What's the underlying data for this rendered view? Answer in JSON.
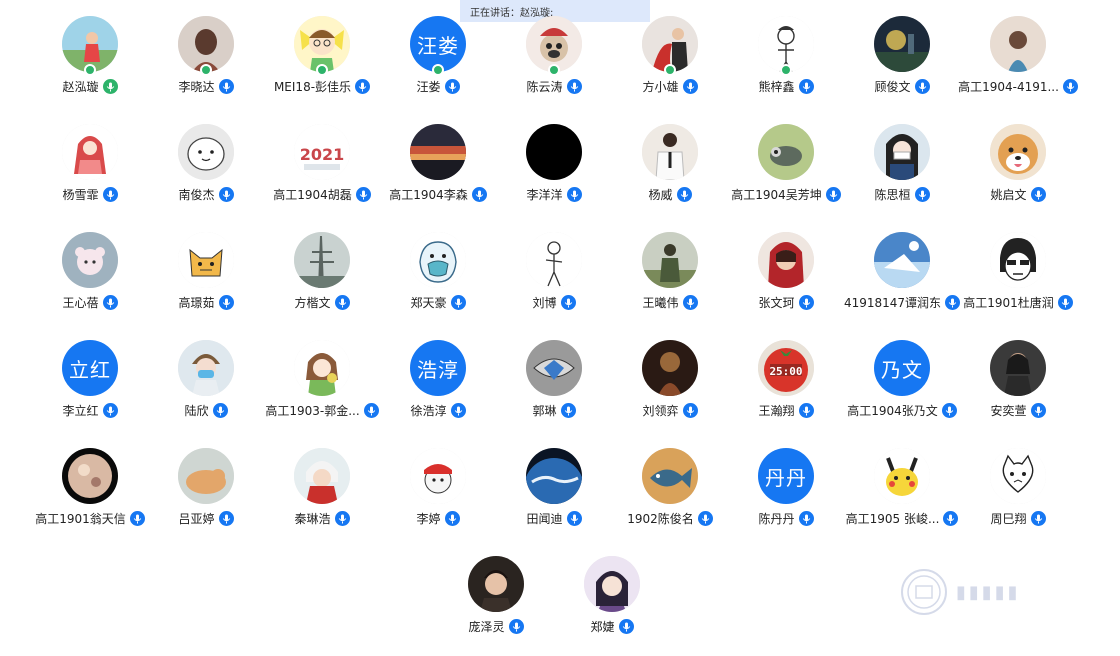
{
  "banner": {
    "text": "正在讲话：赵泓璇;"
  },
  "colors": {
    "accent": "#1677f2",
    "status_green": "#2db36a",
    "banner_bg": "#dde8fb"
  },
  "participants": [
    {
      "name": "赵泓璇",
      "avatar": "photo-girl-garden",
      "mic": "green",
      "status": true
    },
    {
      "name": "李晓达",
      "avatar": "photo-girl-back",
      "mic": "blue",
      "status": true
    },
    {
      "name": "MEI18-彭佳乐",
      "avatar": "cartoon-boy-yellow",
      "mic": "blue",
      "status": true
    },
    {
      "name": "汪娄",
      "avatar_text": "汪娄",
      "mic": "blue",
      "status": true
    },
    {
      "name": "陈云涛",
      "avatar": "cartoon-pug-opera",
      "mic": "blue",
      "status": true
    },
    {
      "name": "方小雄",
      "avatar": "photo-couple-red",
      "mic": "blue",
      "status": true
    },
    {
      "name": "熊梓鑫",
      "avatar": "sketch-figure",
      "mic": "blue",
      "status": true
    },
    {
      "name": "顾俊文",
      "avatar": "photo-night-city",
      "mic": "blue",
      "status": false
    },
    {
      "name": "高工1904-4191...",
      "avatar": "photo-child-beige",
      "mic": "blue",
      "status": false
    },
    {
      "name": "杨雪霏",
      "avatar": "cartoon-red-hood",
      "mic": "blue",
      "status": false
    },
    {
      "name": "南俊杰",
      "avatar": "cartoon-white-blob",
      "mic": "blue",
      "status": false
    },
    {
      "name": "高工1904胡磊",
      "avatar": "text-2021",
      "mic": "blue",
      "status": false
    },
    {
      "name": "高工1904李森",
      "avatar": "photo-sunset-sky",
      "mic": "blue",
      "status": false
    },
    {
      "name": "李洋洋",
      "avatar": "solid-black",
      "mic": "blue",
      "status": false
    },
    {
      "name": "杨威",
      "avatar": "photo-man-shirt",
      "mic": "blue",
      "status": false
    },
    {
      "name": "高工1904吴芳坤",
      "avatar": "cartoon-green-animal",
      "mic": "blue",
      "status": false
    },
    {
      "name": "陈思桓",
      "avatar": "cartoon-girl-mask",
      "mic": "blue",
      "status": false
    },
    {
      "name": "姚启文",
      "avatar": "photo-shiba-dog",
      "mic": "blue",
      "status": false
    },
    {
      "name": "王心蓓",
      "avatar": "cartoon-pink-bear",
      "mic": "blue",
      "status": false
    },
    {
      "name": "高璟茹",
      "avatar": "cartoon-yellow-fox",
      "mic": "blue",
      "status": false
    },
    {
      "name": "方楷文",
      "avatar": "photo-ship-mast",
      "mic": "blue",
      "status": false
    },
    {
      "name": "郑天豪",
      "avatar": "cartoon-blue-mask",
      "mic": "blue",
      "status": false
    },
    {
      "name": "刘博",
      "avatar": "sketch-standing",
      "mic": "blue",
      "status": false
    },
    {
      "name": "王曦伟",
      "avatar": "photo-soldier",
      "mic": "blue",
      "status": false
    },
    {
      "name": "张文珂",
      "avatar": "art-girl-red-hood",
      "mic": "blue",
      "status": false
    },
    {
      "name": "41918147谭润东",
      "avatar": "art-anime-sky",
      "mic": "blue",
      "status": false
    },
    {
      "name": "高工1901杜唐润",
      "avatar": "manga-face",
      "mic": "blue",
      "status": false
    },
    {
      "name": "李立红",
      "avatar_text": "立红",
      "mic": "blue",
      "status": false
    },
    {
      "name": "陆欣",
      "avatar": "anime-boy-mask",
      "mic": "blue",
      "status": false
    },
    {
      "name": "高工1903-郭金...",
      "avatar": "cartoon-girl-green",
      "mic": "blue",
      "status": false
    },
    {
      "name": "徐浩淳",
      "avatar_text": "浩淳",
      "mic": "blue",
      "status": false
    },
    {
      "name": "郭琳",
      "avatar": "art-eye-mask",
      "mic": "blue",
      "status": false
    },
    {
      "name": "刘领弈",
      "avatar": "art-dark-figure",
      "mic": "blue",
      "status": false
    },
    {
      "name": "王瀚翔",
      "avatar": "photo-tomato-clock",
      "mic": "blue",
      "status": false
    },
    {
      "name": "高工1904张乃文",
      "avatar_text": "乃文",
      "mic": "blue",
      "status": false
    },
    {
      "name": "安奕萱",
      "avatar": "photo-woman-dark",
      "mic": "blue",
      "status": false
    },
    {
      "name": "高工1901翁天信",
      "avatar": "photo-planet",
      "mic": "blue",
      "status": false
    },
    {
      "name": "吕亚婷",
      "avatar": "photo-cat-sleeping",
      "mic": "blue",
      "status": false
    },
    {
      "name": "秦琳浩",
      "avatar": "anime-red-character",
      "mic": "blue",
      "status": false
    },
    {
      "name": "李婷",
      "avatar": "cartoon-bear-cap",
      "mic": "blue",
      "status": false
    },
    {
      "name": "田闻迪",
      "avatar": "photo-earth",
      "mic": "blue",
      "status": false
    },
    {
      "name": "1902陈俊名",
      "avatar": "art-fish",
      "mic": "blue",
      "status": false
    },
    {
      "name": "陈丹丹",
      "avatar_text": "丹丹",
      "mic": "blue",
      "status": false
    },
    {
      "name": "高工1905 张峻...",
      "avatar": "cartoon-pikachu",
      "mic": "blue",
      "status": false
    },
    {
      "name": "周巳翔",
      "avatar": "sketch-cat",
      "mic": "blue",
      "status": false
    },
    {
      "name": "庞泽灵",
      "avatar": "photo-young-man",
      "mic": "blue",
      "status": false
    },
    {
      "name": "郑婕",
      "avatar": "anime-girl-purple",
      "mic": "blue",
      "status": false
    }
  ]
}
